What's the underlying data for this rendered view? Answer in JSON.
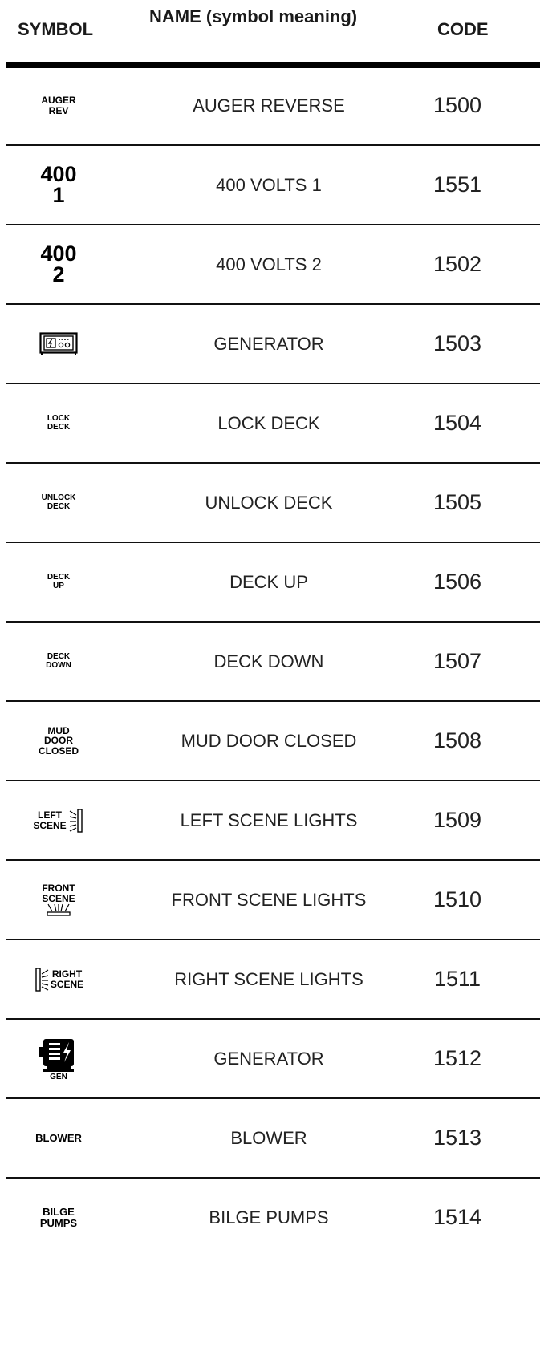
{
  "header": {
    "symbol": "SYMBOL",
    "name": "NAME (symbol meaning)",
    "code": "CODE"
  },
  "rows": [
    {
      "symbol_lines": [
        "AUGER",
        "REV"
      ],
      "name": "AUGER REVERSE",
      "code": "1500"
    },
    {
      "symbol_lines": [
        "400",
        "1"
      ],
      "name": "400 VOLTS 1",
      "code": "1551"
    },
    {
      "symbol_lines": [
        "400",
        "2"
      ],
      "name": "400 VOLTS 2",
      "code": "1502"
    },
    {
      "symbol_icon": "generator-panel-icon",
      "name": "GENERATOR",
      "code": "1503"
    },
    {
      "symbol_lines": [
        "LOCK",
        "DECK"
      ],
      "name": "LOCK DECK",
      "code": "1504"
    },
    {
      "symbol_lines": [
        "UNLOCK",
        "DECK"
      ],
      "name": "UNLOCK DECK",
      "code": "1505"
    },
    {
      "symbol_lines": [
        "DECK",
        "UP"
      ],
      "name": "DECK UP",
      "code": "1506"
    },
    {
      "symbol_lines": [
        "DECK",
        "DOWN"
      ],
      "name": "DECK DOWN",
      "code": "1507"
    },
    {
      "symbol_lines": [
        "MUD",
        "DOOR",
        "CLOSED"
      ],
      "name": "MUD DOOR CLOSED",
      "code": "1508"
    },
    {
      "symbol_lines": [
        "LEFT",
        "SCENE"
      ],
      "symbol_icon": "left-light-icon",
      "name": "LEFT SCENE LIGHTS",
      "code": "1509"
    },
    {
      "symbol_lines": [
        "FRONT",
        "SCENE"
      ],
      "symbol_icon": "front-light-icon",
      "name": "FRONT SCENE LIGHTS",
      "code": "1510"
    },
    {
      "symbol_lines": [
        "RIGHT",
        "SCENE"
      ],
      "symbol_icon": "right-light-icon",
      "name": "RIGHT SCENE LIGHTS",
      "code": "1511"
    },
    {
      "symbol_lines": [
        "GEN"
      ],
      "symbol_icon": "generator-motor-icon",
      "name": "GENERATOR",
      "code": "1512"
    },
    {
      "symbol_lines": [
        "BLOWER"
      ],
      "name": "BLOWER",
      "code": "1513"
    },
    {
      "symbol_lines": [
        "BILGE",
        "PUMPS"
      ],
      "name": "BILGE PUMPS",
      "code": "1514"
    }
  ]
}
